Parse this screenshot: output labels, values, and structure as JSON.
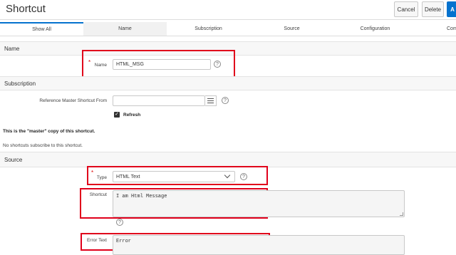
{
  "header": {
    "title": "Shortcut",
    "cancel_label": "Cancel",
    "delete_label": "Delete",
    "apply_label": "A"
  },
  "tabs": [
    "Show All",
    "Name",
    "Subscription",
    "Source",
    "Configuration",
    "Com"
  ],
  "sections": {
    "name": "Name",
    "subscription": "Subscription",
    "source": "Source"
  },
  "name_field": {
    "label": "Name",
    "required_mark": "*",
    "value": "HTML_MSG"
  },
  "subscription": {
    "ref_label": "Reference Master Shortcut From",
    "ref_value": "",
    "refresh_label": "Refresh",
    "master_note": "This is the \"master\" copy of this shortcut.",
    "no_subscribers": "No shortcuts subscribe to this shortcut."
  },
  "source": {
    "type_label": "Type",
    "type_required_mark": "*",
    "type_value": "HTML Text",
    "shortcut_label": "Shortcut",
    "shortcut_value": "I am Html Message",
    "error_label": "Error Text",
    "error_value": "Error"
  },
  "help_glyph": "?",
  "check_glyph": "✓",
  "colors": {
    "accent": "#0572ce",
    "highlight_box": "#e0001b"
  }
}
